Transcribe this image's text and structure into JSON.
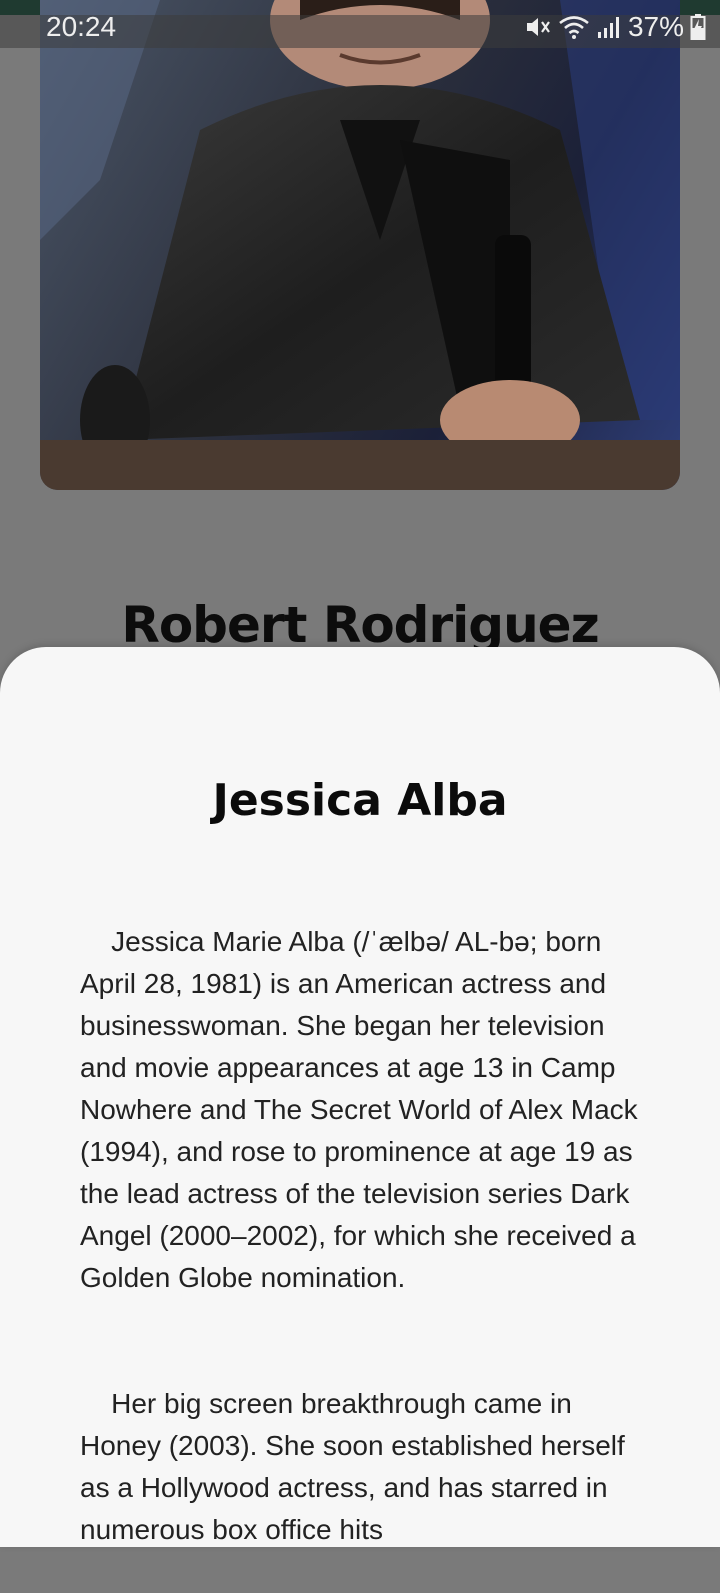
{
  "status_bar": {
    "time": "20:24",
    "battery_percent": "37%"
  },
  "header": {
    "background_name": "Robert Rodriguez"
  },
  "sheet": {
    "title": "Jessica Alba",
    "paragraphs": [
      "Jessica Marie Alba (/ˈælbə/ AL-bə; born April 28, 1981) is an American actress and businesswoman. She began her television and movie appearances at age 13 in Camp Nowhere and The Secret World of Alex Mack (1994), and rose to prominence at age 19 as the lead actress of the television series Dark Angel (2000–2002), for which she received a Golden Globe nomination.",
      "Her big screen breakthrough came in Honey (2003). She soon established herself as a Hollywood actress, and has starred in numerous box office hits"
    ]
  },
  "colors": {
    "dimmed_background": "#7a7a7a",
    "sheet_background": "#f7f7f7",
    "top_strip": "#1f3a30"
  }
}
